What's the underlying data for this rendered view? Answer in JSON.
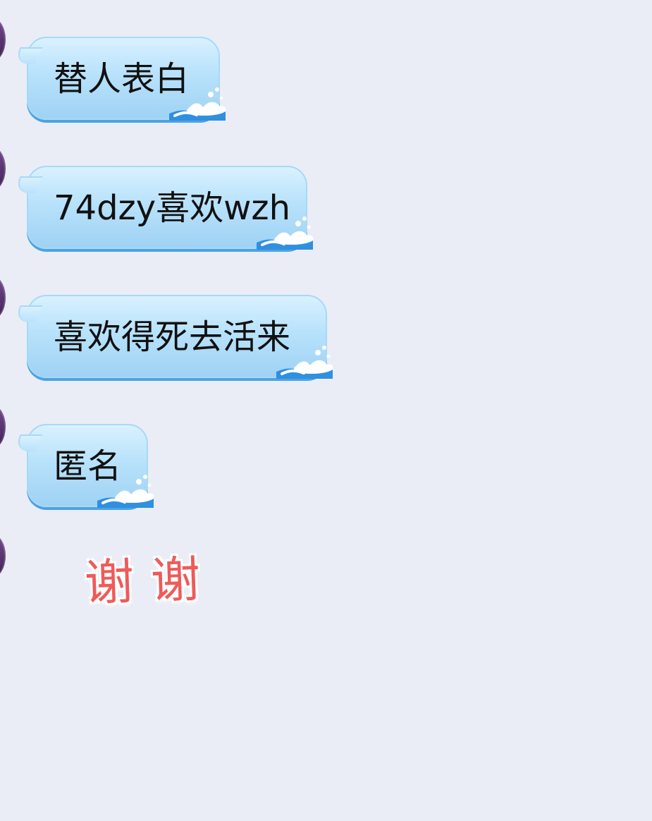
{
  "chat": {
    "messages": [
      {
        "text": "替人表白"
      },
      {
        "text": "74dzy喜欢wzh"
      },
      {
        "text": "喜欢得死去活来"
      },
      {
        "text": "匿名"
      }
    ],
    "sticker": {
      "chars": [
        "谢",
        "谢"
      ]
    }
  },
  "colors": {
    "background": "#EAEDF5",
    "bubble_top": "#D9F1FF",
    "bubble_bottom": "#9FD2F4",
    "bubble_shadow": "#4CA3E2",
    "sticker_text": "#EF5A5A"
  },
  "icons": {
    "avatar": "avatar",
    "bubble_decoration": "wave-icon"
  }
}
